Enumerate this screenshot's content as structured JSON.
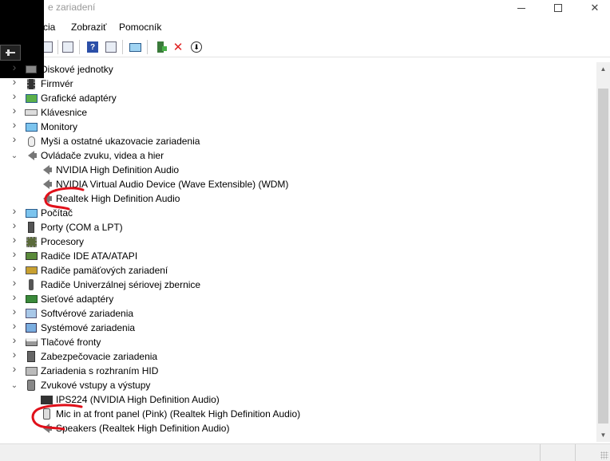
{
  "window": {
    "title": "Správca zariadení",
    "title_visible": "e zariadení"
  },
  "menu": [
    {
      "label": "kcia"
    },
    {
      "label": "Zobraziť"
    },
    {
      "label": "Pomocník"
    }
  ],
  "toolbar": {
    "icons": [
      "back-icon",
      "forward-icon",
      "properties-icon",
      "help-icon",
      "view-icon",
      "scan-hardware-icon",
      "enable-device-icon",
      "uninstall-icon",
      "update-driver-icon"
    ]
  },
  "tree": [
    {
      "label": "Diskové jednotky",
      "expanded": false,
      "icon": "disk-icon"
    },
    {
      "label": "Firmvér",
      "expanded": false,
      "icon": "firmware-icon"
    },
    {
      "label": "Grafické adaptéry",
      "expanded": false,
      "icon": "display-adapter-icon"
    },
    {
      "label": "Klávesnice",
      "expanded": false,
      "icon": "keyboard-icon"
    },
    {
      "label": "Monitory",
      "expanded": false,
      "icon": "monitor-icon"
    },
    {
      "label": "Myši a ostatné ukazovacie zariadenia",
      "expanded": false,
      "icon": "mouse-icon"
    },
    {
      "label": "Ovládače zvuku, videa a hier",
      "expanded": true,
      "icon": "speaker-icon"
    },
    {
      "label": "NVIDIA High Definition Audio",
      "child": true,
      "icon": "speaker-icon"
    },
    {
      "label": "NVIDIA Virtual Audio Device (Wave Extensible) (WDM)",
      "child": true,
      "icon": "speaker-icon"
    },
    {
      "label": "Realtek High Definition Audio",
      "child": true,
      "icon": "speaker-icon"
    },
    {
      "label": "Počítač",
      "expanded": false,
      "icon": "computer-icon"
    },
    {
      "label": "Porty (COM a LPT)",
      "expanded": false,
      "icon": "port-icon"
    },
    {
      "label": "Procesory",
      "expanded": false,
      "icon": "processor-icon"
    },
    {
      "label": "Radiče IDE ATA/ATAPI",
      "expanded": false,
      "icon": "ide-icon"
    },
    {
      "label": "Radiče pamäťových zariadení",
      "expanded": false,
      "icon": "storage-controller-icon"
    },
    {
      "label": "Radiče Univerzálnej sériovej zbernice",
      "expanded": false,
      "icon": "usb-icon"
    },
    {
      "label": "Sieťové adaptéry",
      "expanded": false,
      "icon": "network-icon"
    },
    {
      "label": "Softvérové zariadenia",
      "expanded": false,
      "icon": "software-device-icon"
    },
    {
      "label": "Systémové zariadenia",
      "expanded": false,
      "icon": "system-device-icon"
    },
    {
      "label": "Tlačové fronty",
      "expanded": false,
      "icon": "printer-icon"
    },
    {
      "label": "Zabezpečovacie zariadenia",
      "expanded": false,
      "icon": "security-icon"
    },
    {
      "label": "Zariadenia s rozhraním HID",
      "expanded": false,
      "icon": "hid-icon"
    },
    {
      "label": "Zvukové vstupy a výstupy",
      "expanded": true,
      "icon": "audio-io-icon"
    },
    {
      "label": "IPS224 (NVIDIA High Definition Audio)",
      "child": true,
      "icon": "lcd-icon"
    },
    {
      "label": "Mic in at front panel (Pink) (Realtek High Definition Audio)",
      "child": true,
      "icon": "mic-icon"
    },
    {
      "label": "Speakers (Realtek High Definition Audio)",
      "child": true,
      "icon": "speaker-icon"
    }
  ],
  "annotation_color": "#e0101a"
}
